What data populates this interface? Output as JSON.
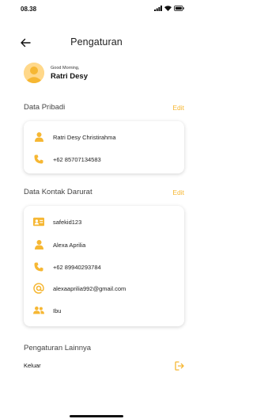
{
  "status_bar": {
    "time": "08.38"
  },
  "header": {
    "title": "Pengaturan"
  },
  "profile": {
    "greeting": "Good Morning,",
    "name": "Ratri Desy"
  },
  "personal": {
    "title": "Data Pribadi",
    "edit_label": "Edit",
    "items": [
      {
        "icon": "person-icon",
        "value": "Ratri Desy Christirahma"
      },
      {
        "icon": "phone-icon",
        "value": "+62 85707134583"
      }
    ]
  },
  "emergency": {
    "title": "Data Kontak Darurat",
    "edit_label": "Edit",
    "items": [
      {
        "icon": "id-card-icon",
        "value": "safekid123"
      },
      {
        "icon": "person-icon",
        "value": "Alexa Aprilia"
      },
      {
        "icon": "phone-icon",
        "value": "+62 89940293784"
      },
      {
        "icon": "at-sign-icon",
        "value": "alexaaprilia992@gmail.com"
      },
      {
        "icon": "people-icon",
        "value": "Ibu"
      }
    ]
  },
  "other": {
    "title": "Pengaturan Lainnya",
    "logout_label": "Keluar",
    "logout_icon": "logout-icon"
  },
  "colors": {
    "accent": "#f6b733",
    "text": "#1f1f1f",
    "muted": "#444444"
  }
}
